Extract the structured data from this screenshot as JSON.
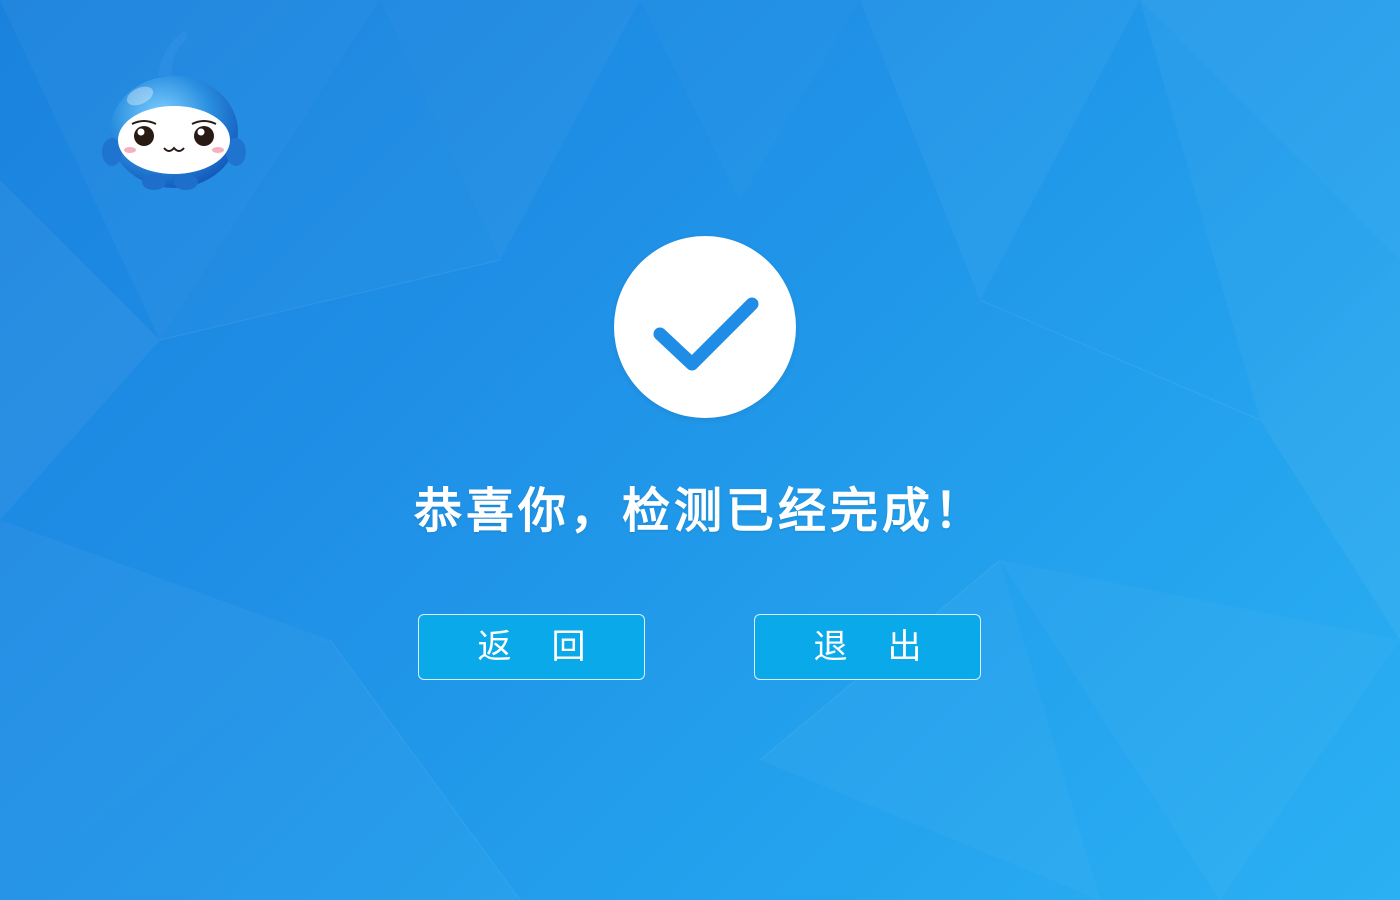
{
  "app": {
    "mascot_icon": "water-drop-mascot-icon"
  },
  "status": {
    "icon": "checkmark-icon",
    "message": "恭喜你，检测已经完成！"
  },
  "actions": {
    "back_label": "返回",
    "exit_label": "退出"
  },
  "colors": {
    "background_start": "#1a82dd",
    "background_end": "#2bb0f3",
    "button_fill": "#0aa9ea",
    "check_color": "#1f8de5"
  }
}
